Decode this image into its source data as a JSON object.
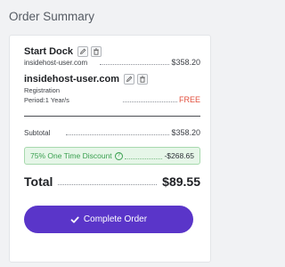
{
  "header": {
    "title": "Order Summary"
  },
  "items": [
    {
      "name": "Start Dock",
      "domain": "insidehost-user.com",
      "price": "$358.20",
      "edit_icon": "pencil-icon",
      "delete_icon": "trash-icon"
    },
    {
      "name": "insidehost-user.com",
      "type": "Registration",
      "period": "Period:1 Year/s",
      "price": "FREE",
      "edit_icon": "pencil-icon",
      "delete_icon": "trash-icon"
    }
  ],
  "subtotal": {
    "label": "Subtotal",
    "value": "$358.20"
  },
  "discount": {
    "label": "75% One Time Discount",
    "help_icon": "question-circle-icon",
    "value": "-$268.65"
  },
  "total": {
    "label": "Total",
    "value": "$89.55"
  },
  "checkout": {
    "label": "Complete Order",
    "icon": "check-icon"
  },
  "colors": {
    "accent": "#5a35c9",
    "free": "#e24e3c",
    "discount_text": "#3aa050",
    "discount_bg": "#e6f6e8"
  }
}
